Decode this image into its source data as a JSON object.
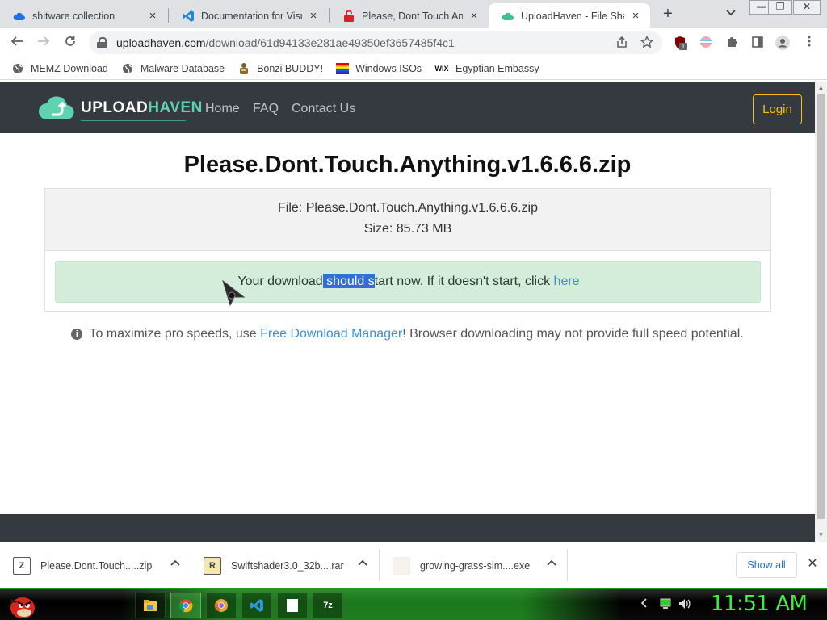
{
  "browser": {
    "tabs": [
      {
        "title": "shitware collection",
        "icon": "cloud-icon"
      },
      {
        "title": "Documentation for Visual",
        "icon": "vscode-icon"
      },
      {
        "title": "Please, Dont Touch Anyth",
        "icon": "lock-red-icon"
      },
      {
        "title": "UploadHaven - File Sharin",
        "icon": "cloud-green-icon"
      }
    ],
    "window_controls": {
      "minimize": "—",
      "restore": "❐",
      "close": "✕"
    },
    "url": {
      "host": "uploadhaven.com",
      "path": "/download/61d94133e281ae49350ef3657485f4c1"
    },
    "extension_badge": "1",
    "bookmarks": [
      {
        "label": "MEMZ Download",
        "icon": "globe-icon"
      },
      {
        "label": "Malware Database",
        "icon": "globe-icon"
      },
      {
        "label": "Bonzi BUDDY!",
        "icon": "bonzi-icon"
      },
      {
        "label": "Windows ISOs",
        "icon": "windows-flag-icon"
      },
      {
        "label": "Egyptian Embassy",
        "icon": "wix-icon"
      }
    ],
    "wix_text": "WIX"
  },
  "site": {
    "brand_upload": "UPLOAD",
    "brand_haven": "HAVEN",
    "nav": [
      "Home",
      "FAQ",
      "Contact Us"
    ],
    "login": "Login",
    "title": "Please.Dont.Touch.Anything.v1.6.6.6.zip",
    "file_line": "File: Please.Dont.Touch.Anything.v1.6.6.6.zip",
    "size_line": "Size: 85.73 MB",
    "alert": {
      "pre": "Your download",
      "selected": " should s",
      "post": "tart now. If it doesn't start, click ",
      "link": "here"
    },
    "pro": {
      "info": "i",
      "pre": " To maximize pro speeds, use ",
      "link": "Free Download Manager",
      "post": "! Browser downloading may not provide full speed potential."
    }
  },
  "downloads": {
    "items": [
      {
        "name": "Please.Dont.Touch.....zip",
        "icon": "zip-file-icon",
        "glyph": "Z"
      },
      {
        "name": "Swiftshader3.0_32b....rar",
        "icon": "rar-file-icon",
        "glyph": "R"
      },
      {
        "name": "growing-grass-sim....exe",
        "icon": "exe-file-icon",
        "glyph": ""
      }
    ],
    "show_all": "Show all"
  },
  "taskbar": {
    "clock": "11:51 AM",
    "apps": [
      "file-explorer-icon",
      "chrome-icon",
      "chrome-canary-icon",
      "vscode-icon",
      "notepad-icon",
      "7zip-icon"
    ],
    "sevenzip": "7z"
  },
  "colors": {
    "navbar": "#343a40",
    "brand_accent": "#5fd3b0",
    "login": "#ffc107",
    "alert_bg": "#d4edda",
    "link": "#3d8fd6",
    "clock": "#3cf03c"
  }
}
